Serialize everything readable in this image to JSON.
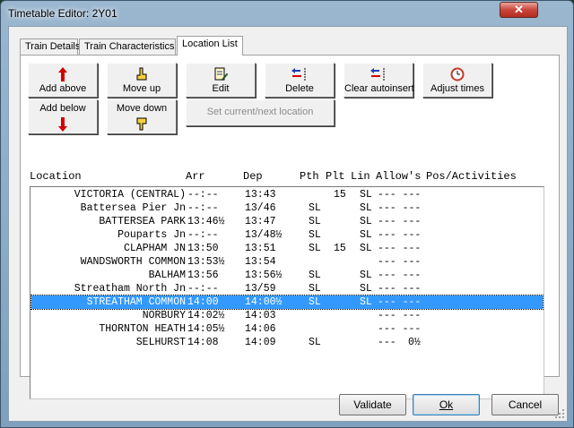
{
  "window": {
    "title": "Timetable Editor: 2Y01",
    "close_glyph": "✕"
  },
  "tabs": [
    {
      "label": "Train Details",
      "active": false
    },
    {
      "label": "Train Characteristics",
      "active": false
    },
    {
      "label": "Location List",
      "active": true
    }
  ],
  "toolbar": {
    "add_above": "Add above",
    "add_below": "Add below",
    "move_up": "Move up",
    "move_down": "Move down",
    "edit": "Edit",
    "delete": "Delete",
    "set_current": "Set current/next location",
    "clear_autoinsert": "Clear autoinsert",
    "adjust_times": "Adjust times"
  },
  "columns": {
    "location": "Location",
    "arr": "Arr",
    "dep": "Dep",
    "pth": "Pth",
    "plt": "Plt",
    "lin": "Lin",
    "allows": "Allow's",
    "pos": "Pos/Activities"
  },
  "rows": [
    {
      "location": "VICTORIA (CENTRAL)",
      "arr": "--:--",
      "dep": "13:43",
      "pth": "",
      "plt": "15",
      "lin": "SL",
      "allow": "--- ---",
      "pos": "",
      "selected": false
    },
    {
      "location": "Battersea Pier Jn",
      "arr": "--:--",
      "dep": "13/46",
      "pth": "SL",
      "plt": "",
      "lin": "SL",
      "allow": "--- ---",
      "pos": "",
      "selected": false
    },
    {
      "location": "BATTERSEA PARK",
      "arr": "13:46½",
      "dep": "13:47",
      "pth": "SL",
      "plt": "",
      "lin": "SL",
      "allow": "--- ---",
      "pos": "",
      "selected": false
    },
    {
      "location": "Pouparts Jn",
      "arr": "--:--",
      "dep": "13/48½",
      "pth": "SL",
      "plt": "",
      "lin": "SL",
      "allow": "--- ---",
      "pos": "",
      "selected": false
    },
    {
      "location": "CLAPHAM JN",
      "arr": "13:50",
      "dep": "13:51",
      "pth": "SL",
      "plt": "15",
      "lin": "SL",
      "allow": "--- ---",
      "pos": "",
      "selected": false
    },
    {
      "location": "WANDSWORTH COMMON",
      "arr": "13:53½",
      "dep": "13:54",
      "pth": "",
      "plt": "",
      "lin": "",
      "allow": "--- ---",
      "pos": "",
      "selected": false
    },
    {
      "location": "BALHAM",
      "arr": "13:56",
      "dep": "13:56½",
      "pth": "SL",
      "plt": "",
      "lin": "SL",
      "allow": "--- ---",
      "pos": "",
      "selected": false
    },
    {
      "location": "Streatham North Jn",
      "arr": "--:--",
      "dep": "13/59",
      "pth": "SL",
      "plt": "",
      "lin": "SL",
      "allow": "--- ---",
      "pos": "",
      "selected": false
    },
    {
      "location": "STREATHAM COMMON",
      "arr": "14:00",
      "dep": "14:00½",
      "pth": "SL",
      "plt": "",
      "lin": "SL",
      "allow": "--- ---",
      "pos": "",
      "selected": true
    },
    {
      "location": "NORBURY",
      "arr": "14:02½",
      "dep": "14:03",
      "pth": "",
      "plt": "",
      "lin": "",
      "allow": "--- ---",
      "pos": "",
      "selected": false
    },
    {
      "location": "THORNTON HEATH",
      "arr": "14:05½",
      "dep": "14:06",
      "pth": "",
      "plt": "",
      "lin": "",
      "allow": "--- ---",
      "pos": "",
      "selected": false
    },
    {
      "location": "SELHURST",
      "arr": "14:08",
      "dep": "14:09",
      "pth": "SL",
      "plt": "",
      "lin": "",
      "allow": "---",
      "pos": "0½",
      "selected": false
    }
  ],
  "buttons": {
    "validate": "Validate",
    "ok": "Ok",
    "cancel": "Cancel"
  },
  "colors": {
    "selection": "#3399ff",
    "arrow_up": "#d40000",
    "arrow_down": "#d40000",
    "accent_blue": "#1b3fb5"
  }
}
